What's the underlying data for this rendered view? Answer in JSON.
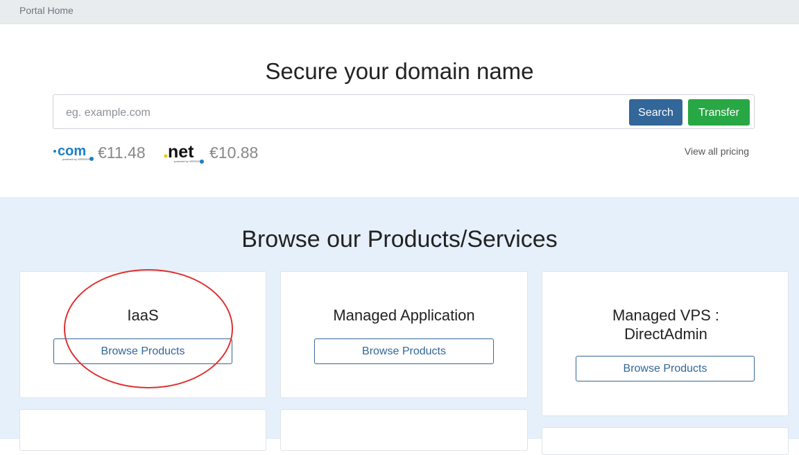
{
  "breadcrumb": {
    "label": "Portal Home"
  },
  "domain_search": {
    "title": "Secure your domain name",
    "placeholder": "eg. example.com",
    "search_label": "Search",
    "transfer_label": "Transfer",
    "tlds": [
      {
        "tld": ".com",
        "price": "€11.48",
        "icon": "com-logo"
      },
      {
        "tld": ".net",
        "price": "€10.88",
        "icon": "net-logo"
      }
    ],
    "view_pricing_label": "View all pricing"
  },
  "products": {
    "title": "Browse our Products/Services",
    "cards": [
      {
        "title": "IaaS",
        "button": "Browse Products"
      },
      {
        "title": "Managed Application",
        "button": "Browse Products"
      },
      {
        "title": "Managed VPS : DirectAdmin",
        "button": "Browse Products"
      }
    ]
  },
  "colors": {
    "primary": "#336699",
    "success": "#28a745",
    "products_bg": "#e6f0fb",
    "annotation": "#e03030"
  }
}
